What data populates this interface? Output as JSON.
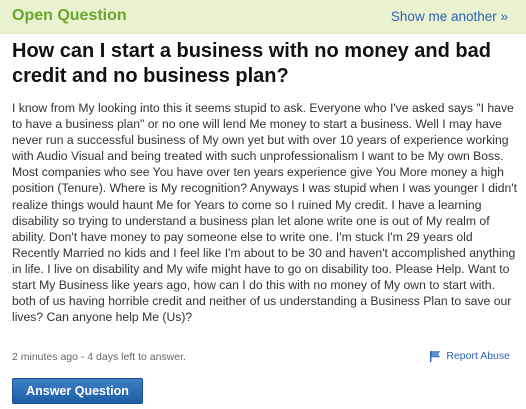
{
  "header": {
    "status_label": "Open Question",
    "show_more_link": "Show me another »"
  },
  "question": {
    "title": "How can I start a business with no money and bad credit and no business plan?",
    "body": "I know from My looking into this it seems stupid to ask. Everyone who I've asked says \"I have to have a business plan\" or no one will lend Me money to start a business. Well I may have never run a successful business of My own yet but with over 10 years of experience working with Audio Visual and being treated with such unprofessionalism I want to be My own Boss. Most companies who see You have over ten years experience give You More money a high position (Tenure). Where is My recognition? Anyways I was stupid when I was younger I didn't realize things would haunt Me for Years to come so I ruined My credit. I have a learning disability so trying to understand a business plan let alone write one is out of My realm of ability. Don't have money to pay someone else to write one. I'm stuck I'm 29 years old Recently Married no kids and I feel like I'm about to be 30 and haven't accomplished anything in life. I live on disability and My wife might have to go on disability too. Please Help. Want to start My Business like years ago, how can I do this with no money of My own to start with. both of us having horrible credit and neither of us understanding a Business Plan to save our lives? Can anyone help Me (Us)?",
    "meta": "2 minutes ago - 4 days left to answer."
  },
  "actions": {
    "report_abuse": "Report Abuse",
    "answer_button": "Answer Question"
  },
  "colors": {
    "header_bg": "#eaf2d0",
    "status_green": "#6aa52b",
    "link_blue": "#2c62b0",
    "button_blue": "#1f5ea6"
  },
  "icons": {
    "report": "flag-icon"
  }
}
